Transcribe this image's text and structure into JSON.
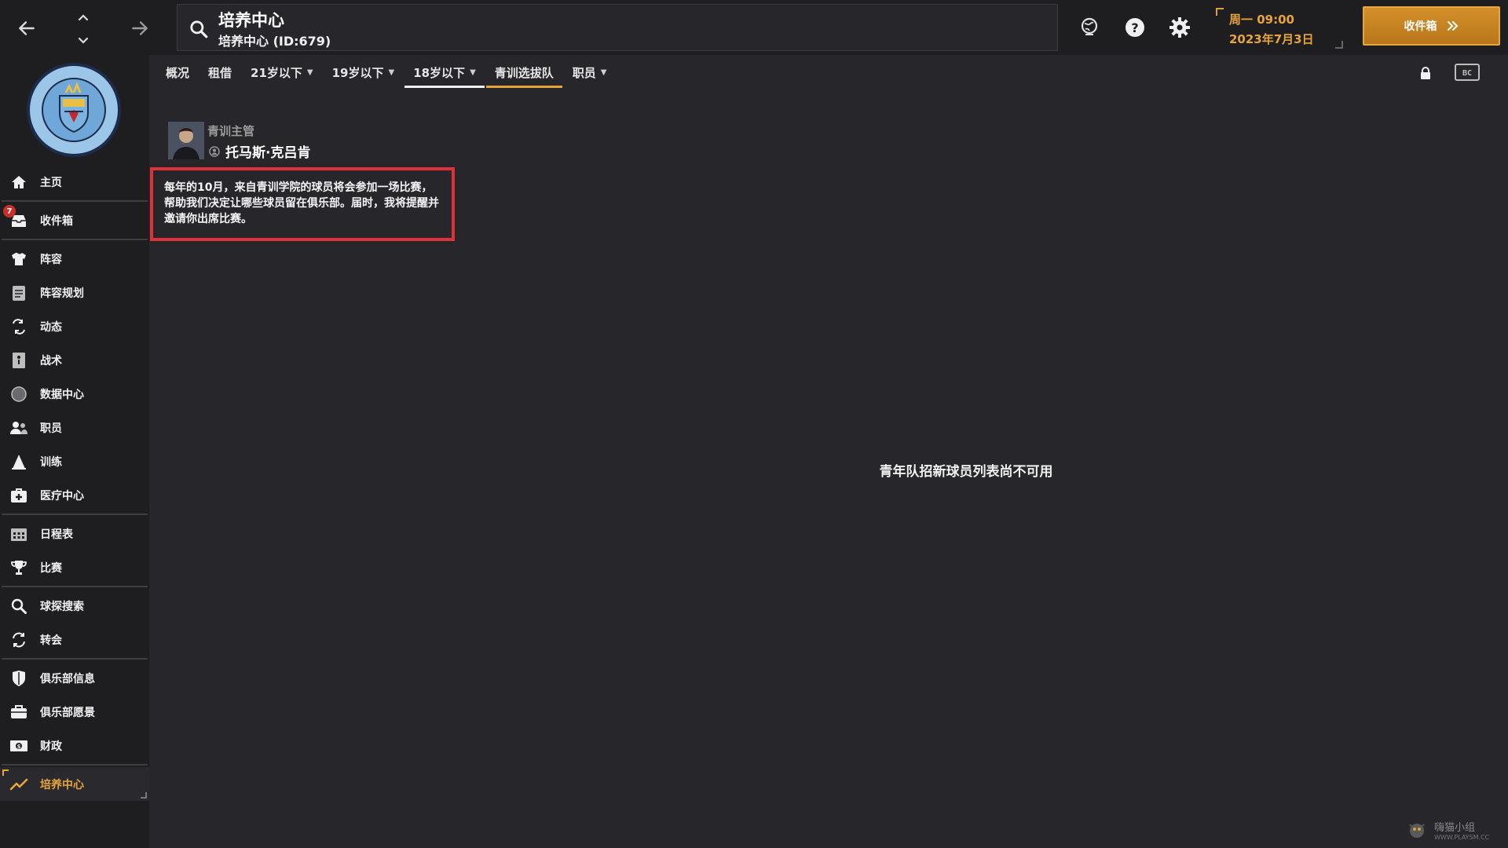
{
  "search": {
    "title": "培养中心",
    "subtitle": "培养中心 (ID:679)"
  },
  "clock": {
    "time": "周一 09:00",
    "date": "2023年7月3日"
  },
  "inbox_button": {
    "label": "收件箱"
  },
  "sidebar": {
    "items": [
      {
        "label": "主页",
        "icon": "home-icon"
      },
      {
        "label": "收件箱",
        "icon": "inbox-icon",
        "badge": "7"
      },
      {
        "label": "阵容",
        "icon": "shirt-icon"
      },
      {
        "label": "阵容规划",
        "icon": "clipboard-icon"
      },
      {
        "label": "动态",
        "icon": "dynamics-icon"
      },
      {
        "label": "战术",
        "icon": "tactics-icon"
      },
      {
        "label": "数据中心",
        "icon": "data-hub-icon"
      },
      {
        "label": "职员",
        "icon": "staff-icon"
      },
      {
        "label": "训练",
        "icon": "training-icon"
      },
      {
        "label": "医疗中心",
        "icon": "medical-icon"
      },
      {
        "label": "日程表",
        "icon": "calendar-icon"
      },
      {
        "label": "比赛",
        "icon": "trophy-icon"
      },
      {
        "label": "球探搜索",
        "icon": "scout-icon"
      },
      {
        "label": "转会",
        "icon": "transfer-icon"
      },
      {
        "label": "俱乐部信息",
        "icon": "shield-icon"
      },
      {
        "label": "俱乐部愿景",
        "icon": "briefcase-icon"
      },
      {
        "label": "财政",
        "icon": "finance-icon"
      },
      {
        "label": "培养中心",
        "icon": "development-icon",
        "active": true
      }
    ]
  },
  "tabs": [
    {
      "label": "概况"
    },
    {
      "label": "租借"
    },
    {
      "label": "21岁以下",
      "dropdown": true
    },
    {
      "label": "19岁以下",
      "dropdown": true
    },
    {
      "label": "18岁以下",
      "dropdown": true
    },
    {
      "label": "青训选拔队"
    },
    {
      "label": "职员",
      "dropdown": true
    }
  ],
  "coach": {
    "role": "青训主管",
    "name": "托马斯·克吕肯"
  },
  "notice": {
    "text": "每年的10月，来自青训学院的球员将会参加一场比赛，帮助我们决定让哪些球员留在俱乐部。届时，我将提醒并邀请你出席比赛。"
  },
  "empty_message": "青年队招新球员列表尚不可用",
  "watermark": {
    "text": "嗨猫小组",
    "url": "WWW.PLAYSM.CC"
  },
  "colors": {
    "accent": "#e8a43a",
    "background": "#27272b",
    "sidebar": "#1e1e21",
    "highlight_border": "#e0303a",
    "badge": "#c9302c"
  }
}
